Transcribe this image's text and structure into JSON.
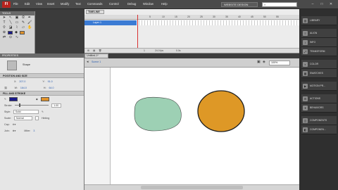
{
  "app": {
    "logo": "Fl",
    "menus": [
      "File",
      "Edit",
      "View",
      "Insert",
      "Modify",
      "Text",
      "Commands",
      "Control",
      "Debug",
      "Window",
      "Help"
    ],
    "workspace": "WEBSITE DESIGN",
    "search_placeholder": "",
    "window_buttons": [
      "–",
      "□",
      "✕"
    ]
  },
  "tools": {
    "title": "TOOLS"
  },
  "timeline": {
    "tab": "TIMELINE",
    "ticks": [
      "5",
      "10",
      "15",
      "20",
      "25",
      "30",
      "35",
      "40",
      "45",
      "50",
      "55"
    ],
    "layer_name": "Layer 1",
    "footer_fps": "24.0 fps",
    "footer_time": "0.0s",
    "footer_frame": "1"
  },
  "document": {
    "tab": "Untitled-1*",
    "scene": "Scene 1",
    "zoom": "100%"
  },
  "properties": {
    "title": "PROPERTIES",
    "object_type": "Shape",
    "section_position": "POSITION AND SIZE",
    "x_label": "X:",
    "x_value": "207.0",
    "y_label": "Y:",
    "y_value": "91.0",
    "w_label": "W:",
    "w_value": "164.0",
    "h_label": "H:",
    "h_value": "64.0",
    "section_fill": "FILL AND STROKE",
    "stroke_label": "Stroke:",
    "stroke_value": "1.00",
    "style_label": "Style:",
    "style_value": "Solid",
    "scale_label": "Scale:",
    "scale_value": "Normal",
    "hinting_label": "Hinting",
    "cap_label": "Cap:",
    "join_label": "Join:",
    "miter_label": "Miter:",
    "miter_value": "3",
    "stroke_color": "#1a1a8a",
    "fill_color": "#e0922a"
  },
  "dock": {
    "items": [
      "LIBRARY",
      "ALIGN",
      "INFO",
      "TRANSFORM",
      "COLOR",
      "SWATCHES",
      "MOTION PR...",
      "ACTIONS",
      "BEHAVIORS",
      "COMPONENTS",
      "COMPONEN..."
    ]
  },
  "stage": {
    "shape1_color": "#9dd0b4",
    "shape2_color": "#de9826",
    "stroke_color": "#1d1d1d"
  }
}
